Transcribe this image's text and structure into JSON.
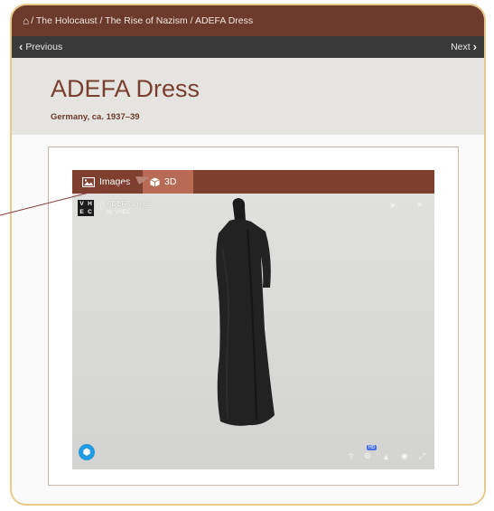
{
  "breadcrumb": {
    "home_icon": "home-icon",
    "text": " / The Holocaust / The Rise of Nazism / ADEFA Dress"
  },
  "nav": {
    "previous_label": "Previous",
    "next_label": "Next"
  },
  "object": {
    "title": "ADEFA Dress",
    "subtitle": "Germany, ca. 1937–39"
  },
  "tabs": [
    {
      "label": "Images",
      "icon": "image-icon",
      "active": false
    },
    {
      "label": "3D",
      "icon": "cube-icon",
      "active": true
    }
  ],
  "viewer": {
    "logo_text": [
      "V",
      "H",
      "E",
      "C"
    ],
    "model_title": "ADEFA Dress",
    "model_author": "by VHEC",
    "hd_badge": "HD"
  },
  "colors": {
    "brand": "#6b3a2a",
    "active_tab": "#b76a54",
    "frame_border": "#e8c98a",
    "viewer_bg": "#d9d9d7"
  }
}
